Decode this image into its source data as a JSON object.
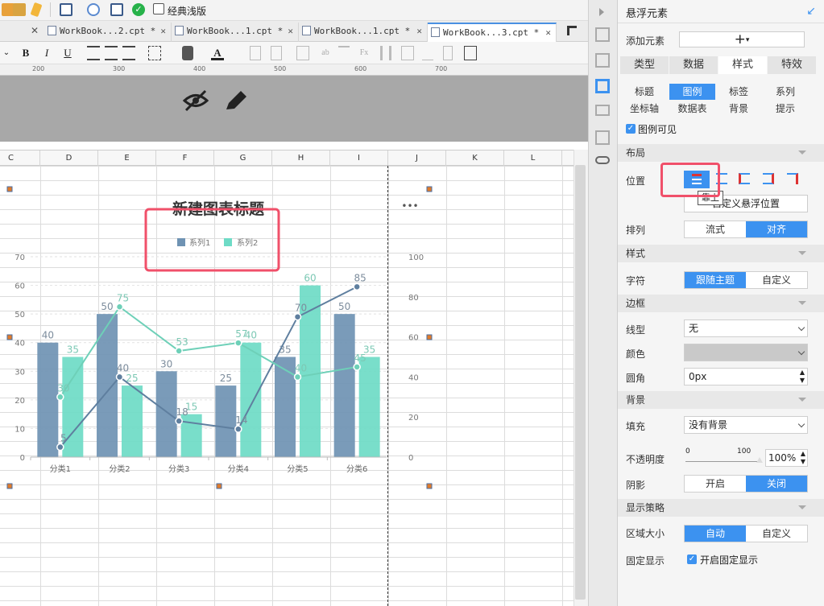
{
  "toolbar": {
    "classic_theme": "经典浅版"
  },
  "tabs": [
    {
      "label": "WorkBook...2.cpt *"
    },
    {
      "label": "WorkBook...1.cpt *"
    },
    {
      "label": "WorkBook...1.cpt *"
    },
    {
      "label": "WorkBook...3.cpt *"
    }
  ],
  "format": {
    "bold": "B",
    "italic": "I",
    "underline": "U"
  },
  "ruler": [
    "200",
    "300",
    "400",
    "500",
    "600",
    "700"
  ],
  "columns": [
    "C",
    "D",
    "E",
    "F",
    "G",
    "H",
    "I",
    "J",
    "K",
    "L"
  ],
  "chart": {
    "title": "新建图表标题",
    "more": "•••",
    "legend": [
      "系列1",
      "系列2"
    ],
    "colors": {
      "series1": "#6f93b3",
      "series2": "#6edbc6",
      "line1": "#5f7f9f",
      "line2": "#6ed0b8"
    }
  },
  "chart_data": {
    "type": "bar",
    "title": "新建图表标题",
    "categories": [
      "分类1",
      "分类2",
      "分类3",
      "分类4",
      "分类5",
      "分类6"
    ],
    "series": [
      {
        "name": "系列1",
        "type": "bar",
        "axis": "left",
        "values": [
          40,
          50,
          30,
          25,
          35,
          50
        ]
      },
      {
        "name": "系列2",
        "type": "bar",
        "axis": "left",
        "values": [
          35,
          25,
          15,
          40,
          60,
          35
        ]
      },
      {
        "name": "系列1",
        "type": "line",
        "axis": "right",
        "values": [
          5,
          40,
          18,
          14,
          70,
          85
        ]
      },
      {
        "name": "系列2",
        "type": "line",
        "axis": "right",
        "values": [
          30,
          75,
          53,
          57,
          40,
          45
        ]
      }
    ],
    "ylim_left": [
      0,
      70
    ],
    "yticks_left": [
      "0",
      "10",
      "20",
      "30",
      "40",
      "50",
      "60",
      "70"
    ],
    "ylim_right": [
      0,
      100
    ],
    "yticks_right": [
      "0",
      "20",
      "40",
      "60",
      "80",
      "100"
    ],
    "legend_position": "top"
  },
  "panel": {
    "header": "悬浮元素",
    "add_element": "添加元素",
    "add_symbol": "+",
    "main_tabs": [
      "类型",
      "数据",
      "样式",
      "特效"
    ],
    "sub_tabs": [
      [
        "标题",
        "图例",
        "标签",
        "系列"
      ],
      [
        "坐标轴",
        "数据表",
        "背景",
        "提示"
      ]
    ],
    "legend_visible": "图例可见",
    "layout_section": "布局",
    "position_label": "位置",
    "tooltip": "靠上",
    "custom_float": "自定义悬浮位置",
    "arrange_label": "排列",
    "arrange": [
      "流式",
      "对齐"
    ],
    "style_section": "样式",
    "char_label": "字符",
    "char_opts": [
      "跟随主题",
      "自定义"
    ],
    "border_section": "边框",
    "line_type_label": "线型",
    "line_type": "无",
    "color_label": "颜色",
    "radius_label": "圆角",
    "radius": "0px",
    "bg_section": "背景",
    "fill_label": "填充",
    "fill": "没有背景",
    "opacity_label": "不透明度",
    "opacity_min": "0",
    "opacity_max": "100",
    "opacity": "100%",
    "shadow_label": "阴影",
    "shadow_opts": [
      "开启",
      "关闭"
    ],
    "display_section": "显示策略",
    "area_label": "区域大小",
    "area_opts": [
      "自动",
      "自定义"
    ],
    "fixed_label": "固定显示",
    "fixed_check": "开启固定显示"
  }
}
